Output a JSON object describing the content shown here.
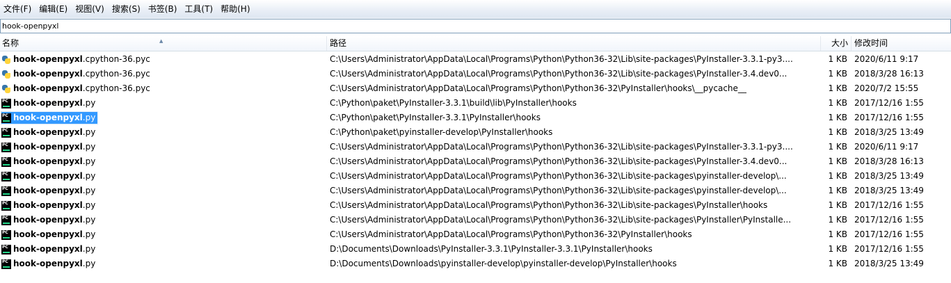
{
  "menu": [
    "文件(F)",
    "编辑(E)",
    "视图(V)",
    "搜索(S)",
    "书签(B)",
    "工具(T)",
    "帮助(H)"
  ],
  "search": {
    "value": "hook-openpyxl"
  },
  "columns": {
    "name": "名称",
    "path": "路径",
    "size": "大小",
    "date": "修改时间"
  },
  "icons": {
    "pyc": "python-file-icon",
    "py": "pycharm-file-icon"
  },
  "rows": [
    {
      "base": "hook-openpyxl",
      "ext": ".cpython-36.pyc",
      "icon": "pyc",
      "path": "C:\\Users\\Administrator\\AppData\\Local\\Programs\\Python\\Python36-32\\Lib\\site-packages\\PyInstaller-3.3.1-py3....",
      "size": "1 KB",
      "date": "2020/6/11 9:17",
      "selected": false
    },
    {
      "base": "hook-openpyxl",
      "ext": ".cpython-36.pyc",
      "icon": "pyc",
      "path": "C:\\Users\\Administrator\\AppData\\Local\\Programs\\Python\\Python36-32\\Lib\\site-packages\\PyInstaller-3.4.dev0...",
      "size": "1 KB",
      "date": "2018/3/28 16:13",
      "selected": false
    },
    {
      "base": "hook-openpyxl",
      "ext": ".cpython-36.pyc",
      "icon": "pyc",
      "path": "C:\\Users\\Administrator\\AppData\\Local\\Programs\\Python\\Python36-32\\PyInstaller\\hooks\\__pycache__",
      "size": "1 KB",
      "date": "2020/7/2 15:55",
      "selected": false
    },
    {
      "base": "hook-openpyxl",
      "ext": ".py",
      "icon": "py",
      "path": "C:\\Python\\paket\\PyInstaller-3.3.1\\build\\lib\\PyInstaller\\hooks",
      "size": "1 KB",
      "date": "2017/12/16 1:55",
      "selected": false
    },
    {
      "base": "hook-openpyxl",
      "ext": ".py",
      "icon": "py",
      "path": "C:\\Python\\paket\\PyInstaller-3.3.1\\PyInstaller\\hooks",
      "size": "1 KB",
      "date": "2017/12/16 1:55",
      "selected": true
    },
    {
      "base": "hook-openpyxl",
      "ext": ".py",
      "icon": "py",
      "path": "C:\\Python\\paket\\pyinstaller-develop\\PyInstaller\\hooks",
      "size": "1 KB",
      "date": "2018/3/25 13:49",
      "selected": false
    },
    {
      "base": "hook-openpyxl",
      "ext": ".py",
      "icon": "py",
      "path": "C:\\Users\\Administrator\\AppData\\Local\\Programs\\Python\\Python36-32\\Lib\\site-packages\\PyInstaller-3.3.1-py3....",
      "size": "1 KB",
      "date": "2020/6/11 9:17",
      "selected": false
    },
    {
      "base": "hook-openpyxl",
      "ext": ".py",
      "icon": "py",
      "path": "C:\\Users\\Administrator\\AppData\\Local\\Programs\\Python\\Python36-32\\Lib\\site-packages\\PyInstaller-3.4.dev0...",
      "size": "1 KB",
      "date": "2018/3/28 16:13",
      "selected": false
    },
    {
      "base": "hook-openpyxl",
      "ext": ".py",
      "icon": "py",
      "path": "C:\\Users\\Administrator\\AppData\\Local\\Programs\\Python\\Python36-32\\Lib\\site-packages\\pyinstaller-develop\\...",
      "size": "1 KB",
      "date": "2018/3/25 13:49",
      "selected": false
    },
    {
      "base": "hook-openpyxl",
      "ext": ".py",
      "icon": "py",
      "path": "C:\\Users\\Administrator\\AppData\\Local\\Programs\\Python\\Python36-32\\Lib\\site-packages\\pyinstaller-develop\\...",
      "size": "1 KB",
      "date": "2018/3/25 13:49",
      "selected": false
    },
    {
      "base": "hook-openpyxl",
      "ext": ".py",
      "icon": "py",
      "path": "C:\\Users\\Administrator\\AppData\\Local\\Programs\\Python\\Python36-32\\Lib\\site-packages\\PyInstaller\\hooks",
      "size": "1 KB",
      "date": "2017/12/16 1:55",
      "selected": false
    },
    {
      "base": "hook-openpyxl",
      "ext": ".py",
      "icon": "py",
      "path": "C:\\Users\\Administrator\\AppData\\Local\\Programs\\Python\\Python36-32\\Lib\\site-packages\\PyInstaller\\PyInstalle...",
      "size": "1 KB",
      "date": "2017/12/16 1:55",
      "selected": false
    },
    {
      "base": "hook-openpyxl",
      "ext": ".py",
      "icon": "py",
      "path": "C:\\Users\\Administrator\\AppData\\Local\\Programs\\Python\\Python36-32\\PyInstaller\\hooks",
      "size": "1 KB",
      "date": "2017/12/16 1:55",
      "selected": false
    },
    {
      "base": "hook-openpyxl",
      "ext": ".py",
      "icon": "py",
      "path": "D:\\Documents\\Downloads\\PyInstaller-3.3.1\\PyInstaller-3.3.1\\PyInstaller\\hooks",
      "size": "1 KB",
      "date": "2017/12/16 1:55",
      "selected": false
    },
    {
      "base": "hook-openpyxl",
      "ext": ".py",
      "icon": "py",
      "path": "D:\\Documents\\Downloads\\pyinstaller-develop\\pyinstaller-develop\\PyInstaller\\hooks",
      "size": "1 KB",
      "date": "2018/3/25 13:49",
      "selected": false
    }
  ]
}
